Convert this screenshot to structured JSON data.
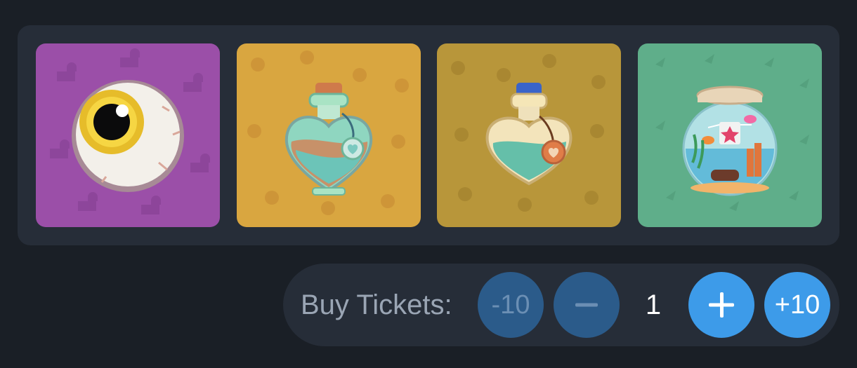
{
  "prizes": [
    {
      "name": "eyeball-icon",
      "background": "#9b4fa8"
    },
    {
      "name": "green-love-potion-icon",
      "background": "#d9a640"
    },
    {
      "name": "blue-love-potion-icon",
      "background": "#b8963a"
    },
    {
      "name": "fish-bowl-icon",
      "background": "#5fae8a"
    }
  ],
  "tickets": {
    "label": "Buy Tickets:",
    "minus10_label": "-10",
    "quantity": "1",
    "plus10_label": "+10"
  },
  "colors": {
    "page_background": "#1a1f26",
    "panel_background": "#262d38",
    "button_active": "#3d9be9",
    "button_disabled": "#2b5b8a"
  }
}
